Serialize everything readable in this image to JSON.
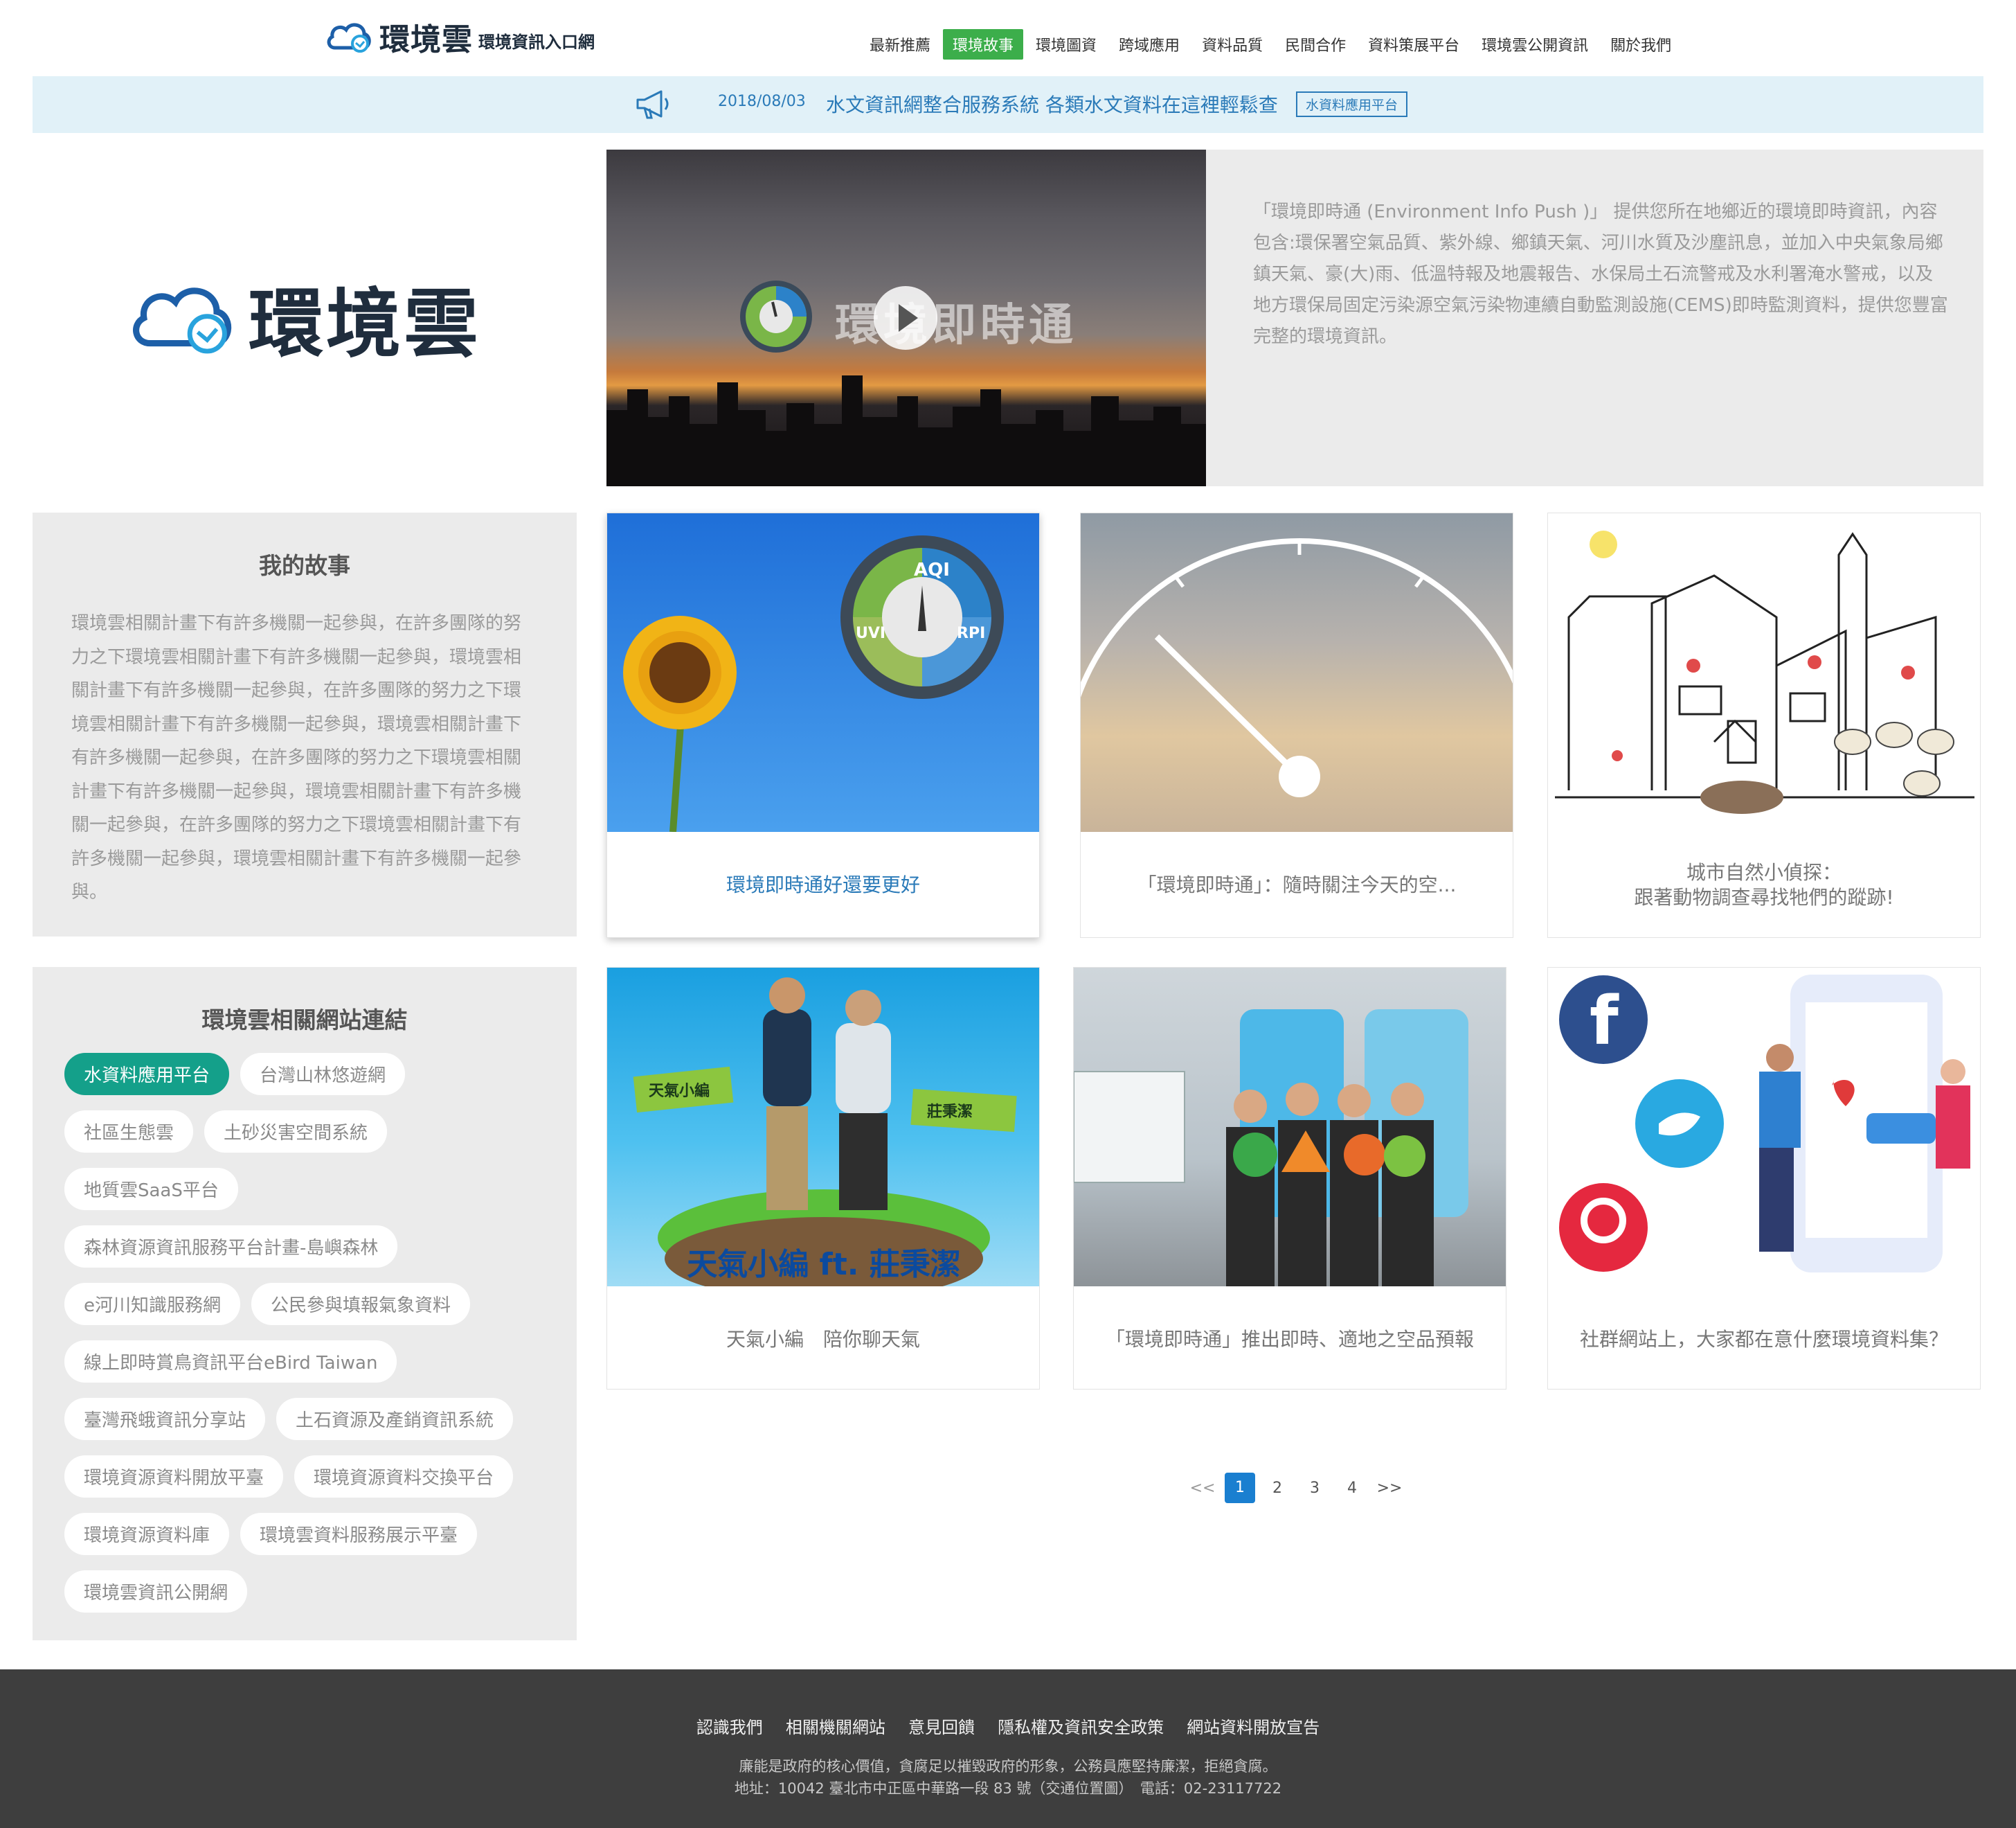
{
  "header": {
    "brand": "環境雲",
    "subtitle": "環境資訊入口網",
    "nav": [
      "最新推薦",
      "環境故事",
      "環境圖資",
      "跨域應用",
      "資料品質",
      "民間合作",
      "資料策展平台",
      "環境雲公開資訊",
      "關於我們"
    ],
    "active_nav": "環境故事"
  },
  "notice": {
    "date": "2018/08/03",
    "title": "水文資訊網整合服務系統 各類水文資料在這裡輕鬆查",
    "tag": "水資料應用平台"
  },
  "hero": {
    "brand": "環境雲",
    "video_title": "環境即時通",
    "description": "「環境即時通 (Environment Info Push )」 提供您所在地鄉近的環境即時資訊，內容包含:環保署空氣品質、紫外線、鄉鎮天氣、河川水質及沙塵訊息，並加入中央氣象局鄉鎮天氣、豪(大)雨、低溫特報及地震報告、水保局土石流警戒及水利署淹水警戒，以及地方環保局固定污染源空氣污染物連續自動監測設施(CEMS)即時監測資料，提供您豐富完整的環境資訊。"
  },
  "story": {
    "title": "我的故事",
    "body": "環境雲相關計畫下有許多機關一起參與，在許多團隊的努力之下環境雲相關計畫下有許多機關一起參與，環境雲相關計畫下有許多機關一起參與，在許多團隊的努力之下環境雲相關計畫下有許多機關一起參與，環境雲相關計畫下有許多機關一起參與，在許多團隊的努力之下環境雲相關計畫下有許多機關一起參與，環境雲相關計畫下有許多機關一起參與，在許多團隊的努力之下環境雲相關計畫下有許多機關一起參與，環境雲相關計畫下有許多機關一起參與。"
  },
  "links": {
    "title": "環境雲相關網站連結",
    "items": [
      "水資料應用平台",
      "台灣山林悠遊網",
      "社區生態雲",
      "土砂災害空間系統",
      "地質雲SaaS平台",
      "森林資源資訊服務平台計畫-島嶼森林",
      "e河川知識服務網",
      "公民參與填報氣象資料",
      "線上即時賞鳥資訊平台eBird Taiwan",
      "臺灣飛蛾資訊分享站",
      "土石資源及產銷資訊系統",
      "環境資源資料開放平臺",
      "環境資源資料交換平台",
      "環境資源資料庫",
      "環境雲資料服務展示平臺",
      "環境雲資訊公開網"
    ]
  },
  "cards": [
    {
      "caption": "環境即時通好還要更好",
      "icon": "aqi-sunflower-image"
    },
    {
      "caption": "「環境即時通」：隨時關注今天的空...",
      "icon": "gauge-sky-image"
    },
    {
      "caption": "城市自然小偵探：\n跟著動物調查尋找牠們的蹤跡!",
      "icon": "city-sketch-image"
    },
    {
      "caption": "天氣小編　陪你聊天氣",
      "icon": "weather-host-image",
      "img_text": "天氣小編 ft. 莊秉潔",
      "badge1": "天氣小編",
      "badge2": "莊秉潔"
    },
    {
      "caption": "「環境即時通」推出即時、適地之空品預報",
      "icon": "press-event-image"
    },
    {
      "caption": "社群網站上，大家都在意什麼環境資料集？",
      "icon": "social-media-image"
    }
  ],
  "pagination": {
    "prev": "<<",
    "pages": [
      "1",
      "2",
      "3",
      "4"
    ],
    "active": "1",
    "next": ">>"
  },
  "footer": {
    "links": [
      "認識我們",
      "相關機關網站",
      "意見回饋",
      "隱私權及資訊安全政策",
      "網站資料開放宣告"
    ],
    "line1": "廉能是政府的核心價值，貪腐足以摧毀政府的形象，公務員應堅持廉潔，拒絕貪腐。",
    "line2": "地址：10042 臺北市中正區中華路一段 83 號（交通位置圖）　電話：02-23117722"
  },
  "colors": {
    "accent_green": "#3cae4b",
    "notice_bg": "#e1f1f8",
    "link_blue": "#2a7ab8",
    "pill_active": "#14a08a",
    "footer_bg": "#3e3e3e",
    "pager_active": "#1a7fd0"
  }
}
